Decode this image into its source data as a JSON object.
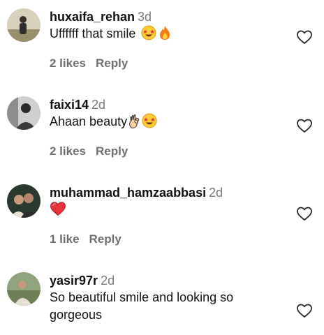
{
  "comments": [
    {
      "username": "huxaifa_rehan",
      "time": "3d",
      "text": "Uffffff that smile",
      "emojis": [
        "star-struck-emoji",
        "fire-emoji"
      ],
      "likes": "2 likes",
      "reply": "Reply"
    },
    {
      "username": "faixi14",
      "time": "2d",
      "text": "Ahaan beauty",
      "emojis": [
        "ok-hand-emoji",
        "star-struck-emoji"
      ],
      "likes": "2 likes",
      "reply": "Reply"
    },
    {
      "username": "muhammad_hamzaabbasi",
      "time": "2d",
      "text": "",
      "emojis": [
        "red-heart-emoji"
      ],
      "likes": "1 like",
      "reply": "Reply"
    },
    {
      "username": "yasir97r",
      "time": "2d",
      "text": "So beautiful smile and looking so gorgeous",
      "emojis": []
    }
  ],
  "colors": {
    "username": "#111111",
    "meta": "#7a7a7a",
    "heart_outline": "#262626",
    "emoji_yellow": "#ffcc33",
    "emoji_red": "#e8323c"
  }
}
